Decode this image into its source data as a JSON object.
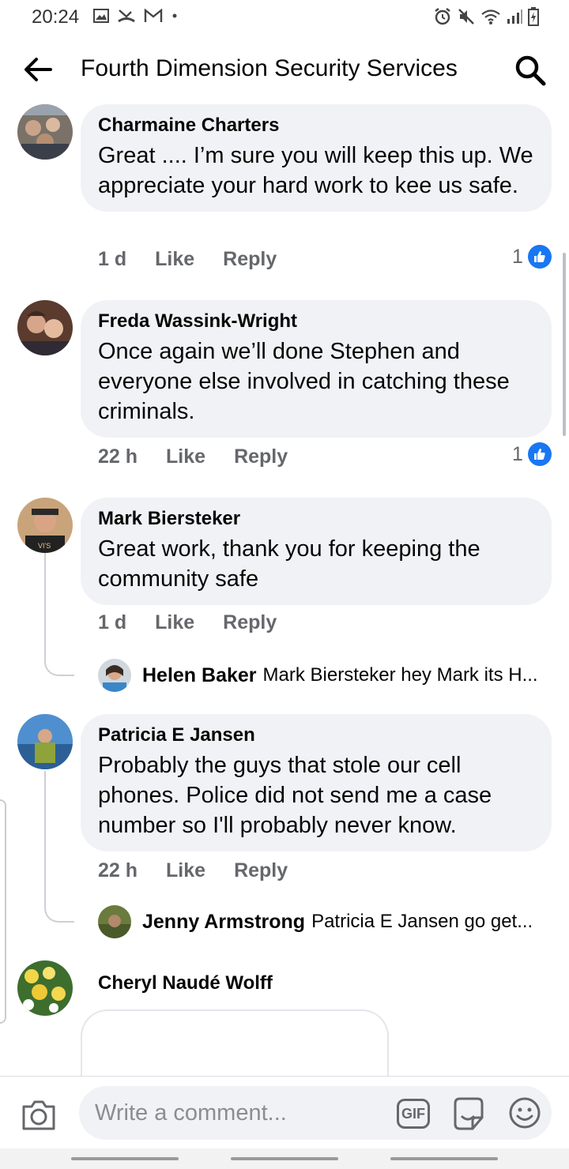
{
  "status_bar": {
    "time": "20:24",
    "left_icons": [
      "image-icon",
      "missed-call-icon",
      "gmail-icon",
      "dot-icon"
    ],
    "right_icons": [
      "alarm-icon",
      "mute-icon",
      "wifi-icon",
      "signal-icon",
      "battery-icon"
    ]
  },
  "header": {
    "title": "Fourth Dimension Security Services",
    "back_icon": "arrow-left-icon",
    "search_icon": "search-icon"
  },
  "comments": [
    {
      "author": "Charmaine Charters",
      "text": "Great .... I’m sure you will keep this up. We appreciate your hard work to kee us safe.",
      "time": "1 d",
      "like_label": "Like",
      "reply_label": "Reply",
      "reactions": "1"
    },
    {
      "author": "Freda Wassink-Wright",
      "text": "Once again we’ll done Stephen and everyone else involved in catching these criminals.",
      "time": "22 h",
      "like_label": "Like",
      "reply_label": "Reply",
      "reactions": "1"
    },
    {
      "author": "Mark Biersteker",
      "text": "Great work, thank you for keeping the community safe",
      "time": "1 d",
      "like_label": "Like",
      "reply_label": "Reply",
      "reply_preview": {
        "author": "Helen Baker",
        "snippet": "Mark Biersteker hey Mark its H..."
      }
    },
    {
      "author": "Patricia E Jansen",
      "text": "Probably the guys that stole our cell phones.  Police did not send me a case number  so I'll probably never know.",
      "time": "22 h",
      "like_label": "Like",
      "reply_label": "Reply",
      "reply_preview": {
        "author": "Jenny Armstrong",
        "snippet": "Patricia E Jansen go get..."
      }
    },
    {
      "author": "Cheryl Naudé Wolff"
    }
  ],
  "composer": {
    "placeholder": "Write a comment...",
    "gif_label": "GIF",
    "camera_icon": "camera-icon",
    "sticker_icon": "sticker-icon",
    "emoji_icon": "emoji-icon"
  },
  "colors": {
    "bubble": "#f0f2f5",
    "meta_text": "#65676b",
    "like_blue": "#1877f2"
  }
}
